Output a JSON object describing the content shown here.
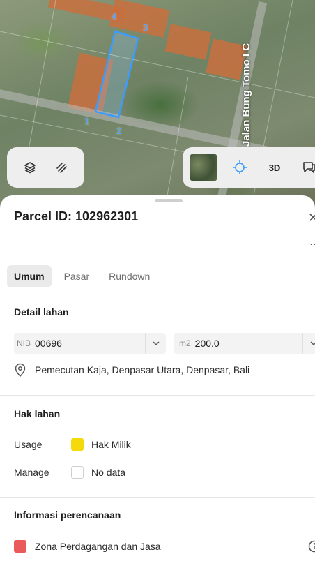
{
  "map": {
    "street_label": "Jalan Bung Tomo I C",
    "vertex_labels": [
      "1",
      "2",
      "3",
      "4"
    ],
    "layers_icon": "layers-icon",
    "measure_icon": "ruler-icon",
    "locate_icon": "crosshair-icon",
    "view_3d_label": "3D",
    "feedback_icon": "chat-icon",
    "parcel_outline_color": "#3b9cff"
  },
  "sheet": {
    "title": "Parcel ID: 102962301",
    "close_icon": "close-icon",
    "more_icon": "more-icon",
    "tabs": [
      {
        "label": "Umum",
        "active": true
      },
      {
        "label": "Pasar",
        "active": false
      },
      {
        "label": "Rundown",
        "active": false
      }
    ],
    "detail": {
      "title": "Detail lahan",
      "nib_prefix": "NIB",
      "nib_value": "00696",
      "area_prefix": "m2",
      "area_value": "200.0",
      "location": "Pemecutan Kaja, Denpasar Utara, Denpasar, Bali"
    },
    "rights": {
      "title": "Hak lahan",
      "rows": [
        {
          "label": "Usage",
          "value": "Hak Milik",
          "color": "#f5d90a"
        },
        {
          "label": "Manage",
          "value": "No data",
          "color": "#ffffff"
        }
      ]
    },
    "planning": {
      "title": "Informasi perencanaan",
      "zone": "Zona Perdagangan dan Jasa",
      "zone_color": "#ea5a5a"
    }
  }
}
